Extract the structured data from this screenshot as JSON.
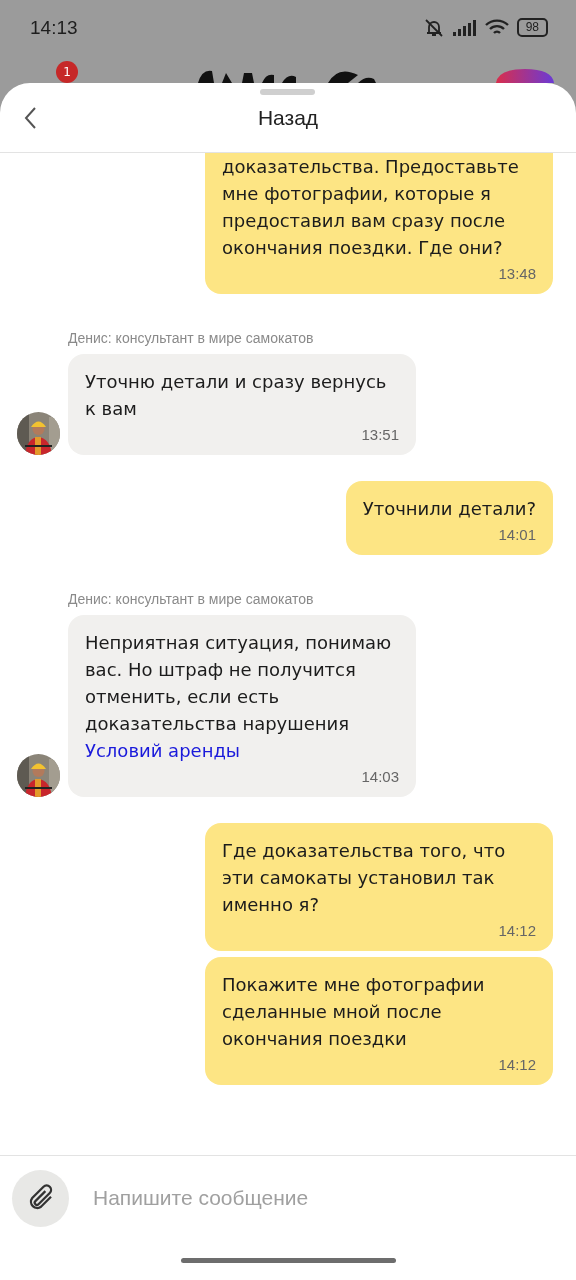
{
  "status_bar": {
    "time": "14:13",
    "battery": "98"
  },
  "background": {
    "notification_count": "1"
  },
  "header": {
    "title": "Назад"
  },
  "messages": [
    {
      "kind": "outgoing",
      "text": "доказательства. Предоставьте мне фотографии, которые я предоставил вам сразу после окончания поездки. Где они?",
      "time": "13:48",
      "cut_top": true
    },
    {
      "kind": "incoming",
      "sender": "Денис: консультант в мире самокатов",
      "text": "Уточню детали и сразу вернусь к вам",
      "time": "13:51"
    },
    {
      "kind": "outgoing",
      "text": "Уточнили детали?",
      "time": "14:01"
    },
    {
      "kind": "incoming",
      "sender": "Денис: консультант в мире самокатов",
      "text": "Неприятная ситуация, понимаю вас. Но штраф не получится отменить, если есть доказательства нарушения",
      "link": "Условий аренды",
      "time": "14:03"
    },
    {
      "kind": "outgoing",
      "text": "Где доказательства того, что эти самокаты установил так именно я?",
      "time": "14:12"
    },
    {
      "kind": "outgoing",
      "text": "Покажите мне фотографии сделанные мной после окончания поездки",
      "time": "14:12"
    }
  ],
  "composer": {
    "placeholder": "Напишите сообщение"
  }
}
